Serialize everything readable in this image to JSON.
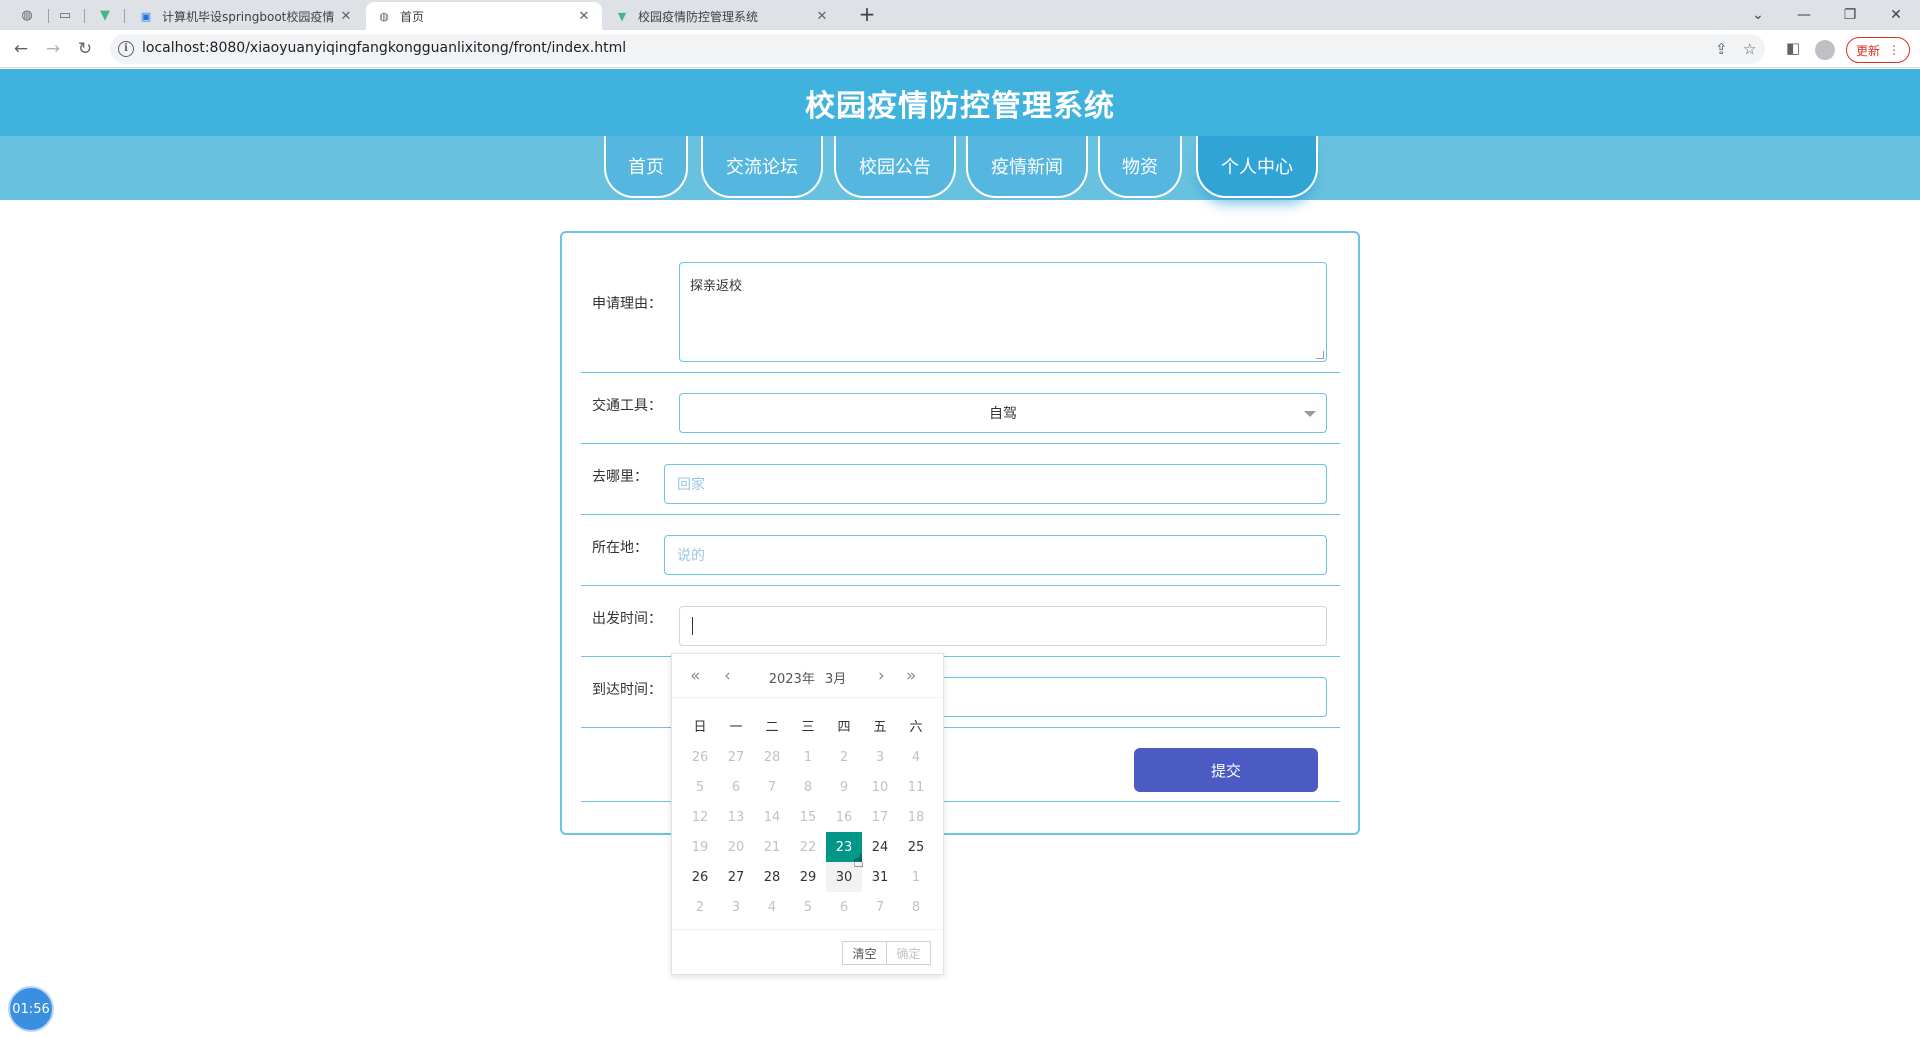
{
  "browser": {
    "tabs": [
      {
        "title": "计算机毕设springboot校园疫情",
        "active": false
      },
      {
        "title": "首页",
        "active": true
      },
      {
        "title": "校园疫情防控管理系统",
        "active": false
      }
    ],
    "url": "localhost:8080/xiaoyuanyiqingfangkongguanlixitong/front/index.html",
    "update_label": "更新"
  },
  "site": {
    "title": "校园疫情防控管理系统",
    "nav": [
      {
        "label": "首页",
        "active": false
      },
      {
        "label": "交流论坛",
        "active": false
      },
      {
        "label": "校园公告",
        "active": false
      },
      {
        "label": "疫情新闻",
        "active": false
      },
      {
        "label": "物资",
        "active": false
      },
      {
        "label": "个人中心",
        "active": true
      }
    ]
  },
  "form": {
    "reason": {
      "label": "申请理由：",
      "value": "探亲返校"
    },
    "transport": {
      "label": "交通工具：",
      "value": "自驾"
    },
    "destination": {
      "label": "去哪里：",
      "placeholder": "回家"
    },
    "location": {
      "label": "所在地：",
      "placeholder": "说的"
    },
    "depart": {
      "label": "出发时间：",
      "value": ""
    },
    "arrive": {
      "label": "到达时间：",
      "value": ""
    },
    "submit_label": "提交"
  },
  "datepicker": {
    "year_label": "2023年",
    "month_label": "3月",
    "weekdays": [
      "日",
      "一",
      "二",
      "三",
      "四",
      "五",
      "六"
    ],
    "days": [
      [
        "26",
        "27",
        "28",
        "1",
        "2",
        "3",
        "4"
      ],
      [
        "5",
        "6",
        "7",
        "8",
        "9",
        "10",
        "11"
      ],
      [
        "12",
        "13",
        "14",
        "15",
        "16",
        "17",
        "18"
      ],
      [
        "19",
        "20",
        "21",
        "22",
        "23",
        "24",
        "25"
      ],
      [
        "26",
        "27",
        "28",
        "29",
        "30",
        "31",
        "1"
      ],
      [
        "2",
        "3",
        "4",
        "5",
        "6",
        "7",
        "8"
      ]
    ],
    "selected": "23",
    "clear_label": "清空",
    "confirm_label": "确定"
  },
  "timer": "01:56"
}
